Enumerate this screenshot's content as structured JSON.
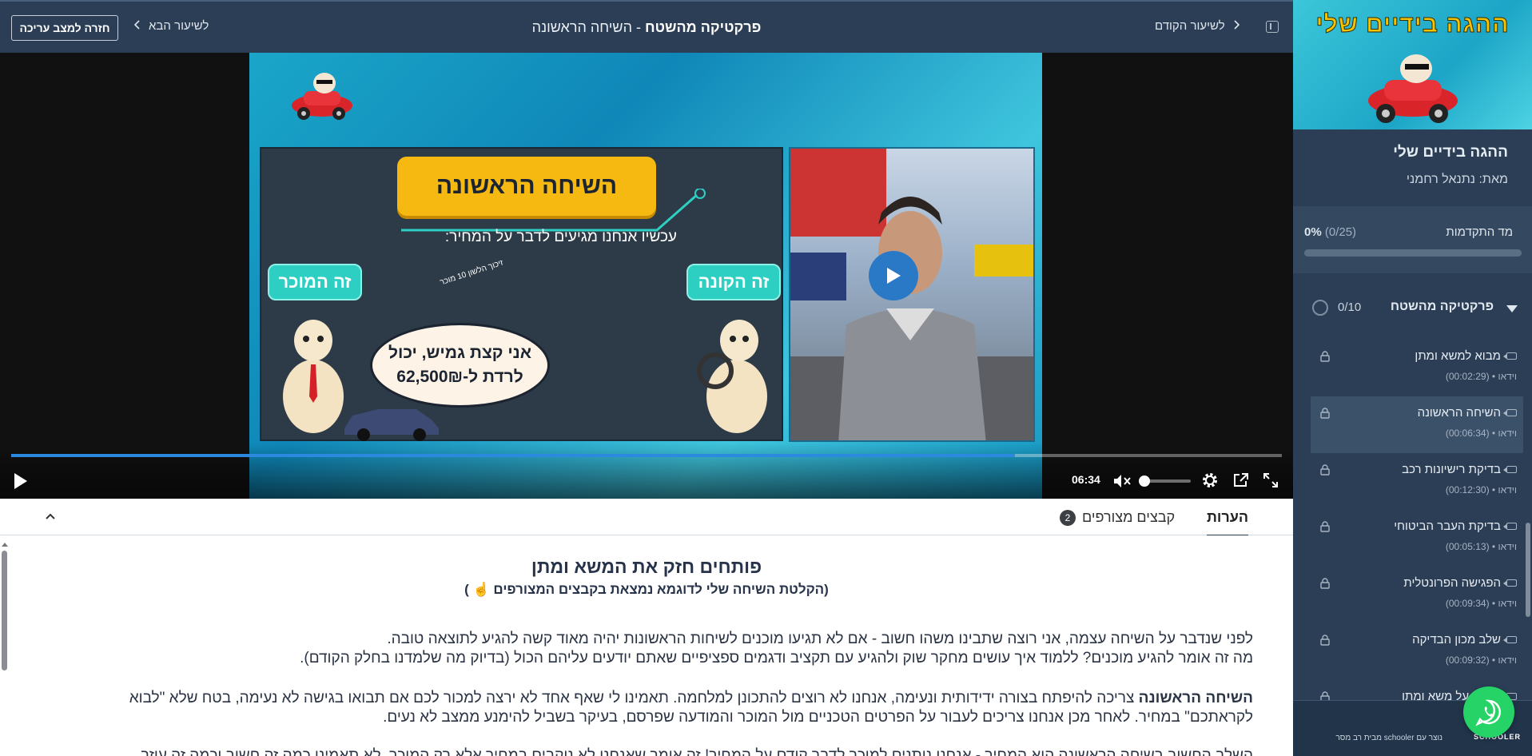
{
  "topbar": {
    "edit_button": "חזרה למצב עריכה",
    "next_lesson": "לשיעור הבא",
    "prev_lesson": "לשיעור הקודם",
    "title_bold": "פרקטיקה מהשטח",
    "title_sep": " - ",
    "title_rest": "השיחה הראשונה"
  },
  "video": {
    "slide_headline": "השיחה הראשונה",
    "slide_subtitle": "עכשיו אנחנו מגיעים לדבר על המחיר:",
    "tag_buyer": "זה הקונה",
    "tag_seller": "זה המוכר",
    "bubble_line1": "אני קצת גמיש, יכול",
    "bubble_line2": "לרדת ל-62,500₪",
    "slide_note": "זיכוך הלשון 10 מוכר",
    "time": "06:34",
    "progress_fraction": 0.79,
    "volume_fraction": 0.0,
    "muted": true
  },
  "tabs": {
    "notes": "הערות",
    "files": "קבצים מצורפים",
    "files_count": "2"
  },
  "content": {
    "heading": "פותחים חזק את המשא ומתן",
    "subheading": "(הקלטת השיחה שלי לדוגמא נמצאת בקבצים המצורפים ☝️ )",
    "p1_line1": "לפני שנדבר על השיחה עצמה, אני רוצה שתבינו משהו חשוב - אם לא תגיעו מוכנים לשיחות הראשונות יהיה מאוד קשה להגיע לתוצאה טובה.",
    "p1_line2": "מה זה אומר להגיע מוכנים? ללמוד איך עושים מחקר שוק ולהגיע עם תקציב ודגמים ספציפיים שאתם יודעים עליהם הכול (בדיוק מה שלמדנו בחלק הקודם).",
    "p2_bold": "השיחה הראשונה",
    "p2_rest": " צריכה להיפתח בצורה ידידותית ונעימה, אנחנו לא רוצים להתכונן למלחמה. תאמינו לי שאף אחד לא ירצה למכור לכם אם תבואו בגישה לא נעימה, בטח שלא \"לבוא",
    "p2_line2": "לקראתכם\" במחיר. לאחר מכן אנחנו צריכים לעבור על הפרטים הטכניים מול המוכר והמודעה שפרסם, בעיקר בשביל להימנע ממצב לא נעים.",
    "p3_line1": "השלב החשוב בשיחה הראשונה הוא המחיר - אנחנו נותנים למוכר לדבר קודם על המחיר! זה אומר שאנחנו לא נוקבים במחיר אלא רק המוכר. לא תאמינו כמה זה חשוב וכמה זה עוזר"
  },
  "sidebar": {
    "banner_title": "ההגה בידיים שלי",
    "course_title": "ההגה בידיים שלי",
    "author": "מאת: נתנאל רחמני",
    "progress_label": "מד התקדמות",
    "progress_value": "0%",
    "progress_count": "(0/25)",
    "progress_fraction": 0,
    "section_name": "פרקטיקה מהשטח",
    "section_count": "0/10",
    "lessons": [
      {
        "title": "מבוא למשא ומתן",
        "meta": "וידאו • (00:02:29)"
      },
      {
        "title": "השיחה הראשונה",
        "meta": "וידאו • (00:06:34)"
      },
      {
        "title": "בדיקת רישיונות רכב",
        "meta": "וידאו • (00:12:30)"
      },
      {
        "title": "בדיקת העבר הביטוחי",
        "meta": "וידאו • (00:05:13)"
      },
      {
        "title": "הפגישה הפרונטלית",
        "meta": "וידאו • (00:09:34)"
      },
      {
        "title": "שלב מכון הבדיקה",
        "meta": "וידאו • (00:09:32)"
      },
      {
        "title": "הפרה על משא ומתן",
        "meta": ""
      }
    ],
    "footer_made": "נוצר עם schooler מבית רב מסר",
    "footer_brand": "SCHOOLER"
  },
  "colors": {
    "topbar": "#2b3e55",
    "accent": "#2b8ae0",
    "whatsapp": "#25d366",
    "headline_yellow": "#f5b912",
    "tag_teal": "#2ecfc3"
  }
}
